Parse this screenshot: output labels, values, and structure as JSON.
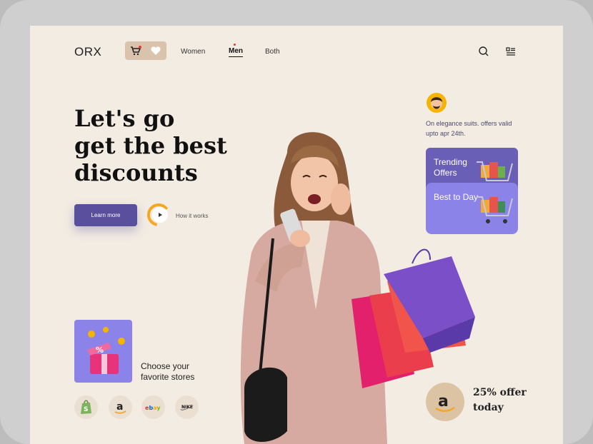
{
  "nav": {
    "logo": "ORX",
    "links": [
      "Women",
      "Men",
      "Both"
    ],
    "active_link": "Men"
  },
  "hero": {
    "headline_line1": "Let's go",
    "headline_line2": "get the best",
    "headline_line3": "discounts",
    "cta_label": "Learn more",
    "secondary_label": "How it works"
  },
  "promo": {
    "text": "On elegance suits. offers valid upto apr 24th.",
    "cards": [
      "Trending Offers",
      "Best to Day"
    ]
  },
  "stores": {
    "heading": "Choose your favorite stores",
    "brands": [
      "Shopify",
      "Amazon",
      "eBay",
      "Nike"
    ]
  },
  "offer": {
    "text": "25% offer today"
  },
  "colors": {
    "background": "#f3ece3",
    "accent": "#5a4f9c",
    "card_light": "#8c83e8",
    "card_dark": "#6a5fb6",
    "gold": "#f5a623"
  },
  "icons": [
    "cart-icon",
    "heart-icon",
    "search-icon",
    "menu-icon",
    "play-icon",
    "amazon-logo-icon"
  ]
}
